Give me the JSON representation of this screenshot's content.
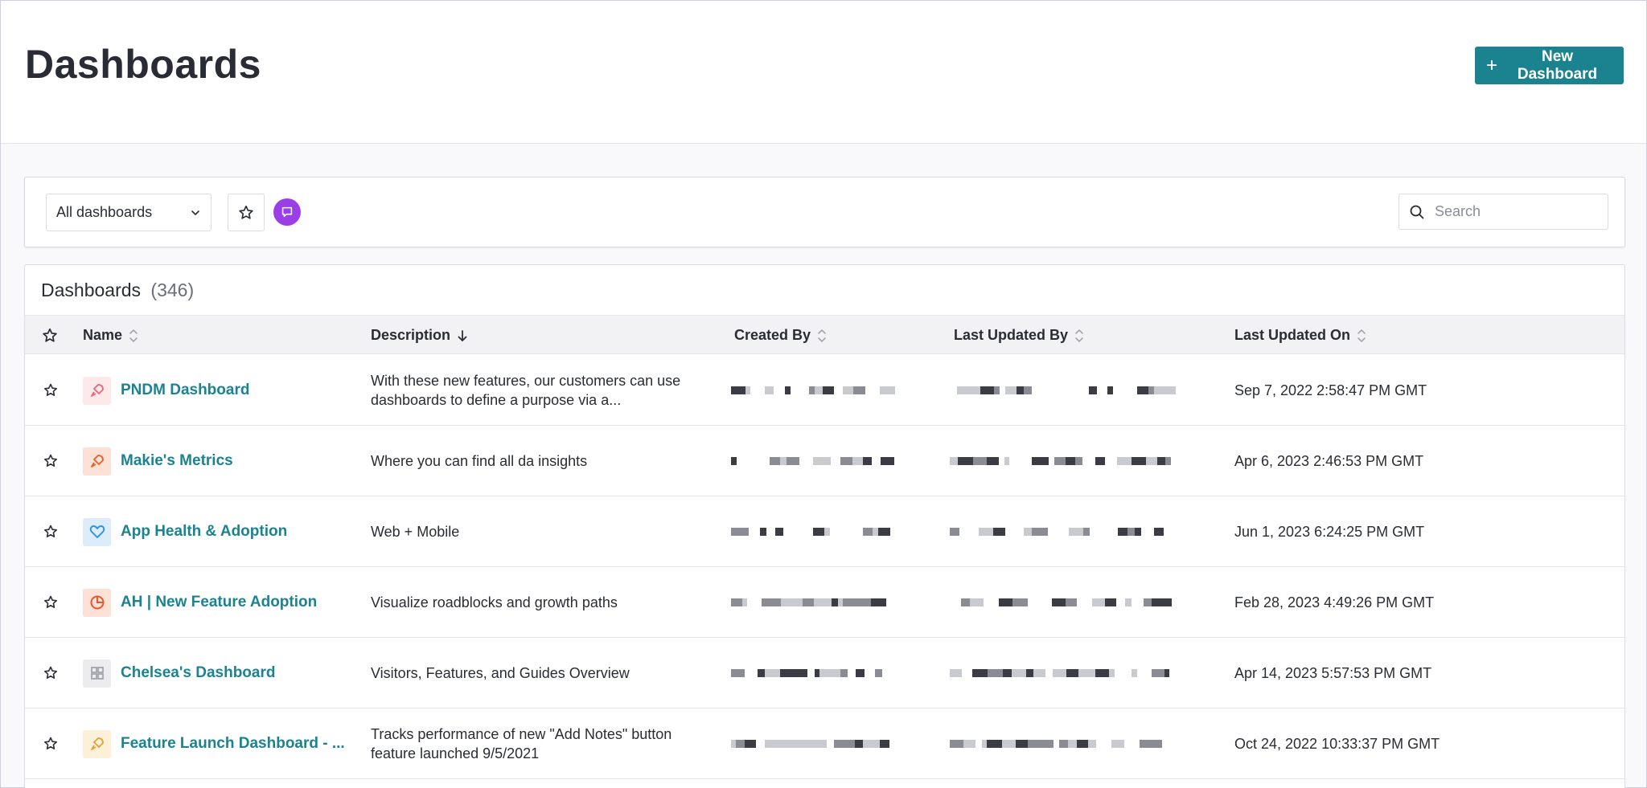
{
  "header": {
    "title": "Dashboards",
    "new_button_label": "New Dashboard"
  },
  "filters": {
    "dropdown_value": "All dashboards",
    "search_placeholder": "Search"
  },
  "table": {
    "title": "Dashboards",
    "count": "(346)",
    "columns": {
      "name": "Name",
      "description": "Description",
      "created_by": "Created By",
      "last_updated_by": "Last Updated By",
      "last_updated_on": "Last Updated On"
    },
    "rows": [
      {
        "name": "PNDM Dashboard",
        "icon": "rocket-icon",
        "icon_bg": "#fde8ea",
        "icon_color": "#e8677a",
        "description": "With these new features, our customers can use dashboards to define a purpose via a...",
        "date": "Sep 7, 2022 2:58:47 PM GMT"
      },
      {
        "name": "Makie's Metrics",
        "icon": "rocket-icon",
        "icon_bg": "#fde0d6",
        "icon_color": "#e2612f",
        "description": "Where you can find all da insights",
        "date": "Apr 6, 2023 2:46:53 PM GMT"
      },
      {
        "name": "App Health & Adoption",
        "icon": "heart-icon",
        "icon_bg": "#dcecfb",
        "icon_color": "#2f8fe0",
        "description": "Web + Mobile",
        "date": "Jun 1, 2023 6:24:25 PM GMT"
      },
      {
        "name": "AH | New Feature Adoption",
        "icon": "pie-chart-icon",
        "icon_bg": "#fde0d6",
        "icon_color": "#e8572a",
        "description": "Visualize roadblocks and growth paths",
        "date": "Feb 28, 2023 4:49:26 PM GMT"
      },
      {
        "name": "Chelsea's Dashboard",
        "icon": "grid-icon",
        "icon_bg": "#ececee",
        "icon_color": "#9a9ca6",
        "description": "Visitors, Features, and Guides Overview",
        "date": "Apr 14, 2023 5:57:53 PM GMT"
      },
      {
        "name": "Feature Launch Dashboard - ...",
        "icon": "rocket-icon",
        "icon_bg": "#fdf0d8",
        "icon_color": "#e6a23a",
        "description": "Tracks performance of new \"Add Notes\" button feature launched 9/5/2021",
        "date": "Oct 24, 2022 10:33:37 PM GMT"
      }
    ]
  },
  "colors": {
    "accent": "#1b8390",
    "chat_purple": "#9b3ee8"
  }
}
